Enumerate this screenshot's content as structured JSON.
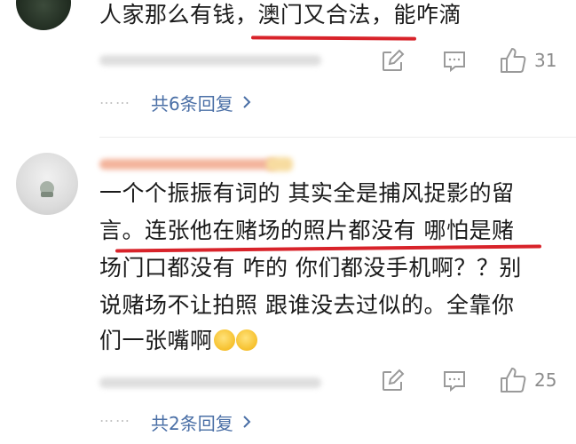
{
  "comments": [
    {
      "lines": [
        "人家那么有钱，澳门又合法，能咋滴"
      ],
      "actions": {
        "edit_icon": "edit-icon",
        "comment_icon": "comment-icon",
        "like_icon": "thumbs-up-icon",
        "like_count": "31"
      },
      "replies_label": "共6条回复",
      "replies_dots": "……"
    },
    {
      "lines": [
        "一个个振振有词的 其实全是捕风捉影的留",
        "言。连张他在赌场的照片都没有 哪怕是赌",
        "场门口都没有 咋的 你们都没手机啊？？别",
        "说赌场不让拍照 跟谁没去过似的。全靠你",
        "们一张嘴啊"
      ],
      "emoji": "smirk-emoji",
      "actions": {
        "edit_icon": "edit-icon",
        "comment_icon": "comment-icon",
        "like_icon": "thumbs-up-icon",
        "like_count": "25"
      },
      "replies_label": "共2条回复",
      "replies_dots": "……"
    }
  ],
  "colors": {
    "text": "#1a1a1a",
    "link": "#4a6fa6",
    "icon": "#9a9a9a",
    "underline": "#d8232a"
  }
}
